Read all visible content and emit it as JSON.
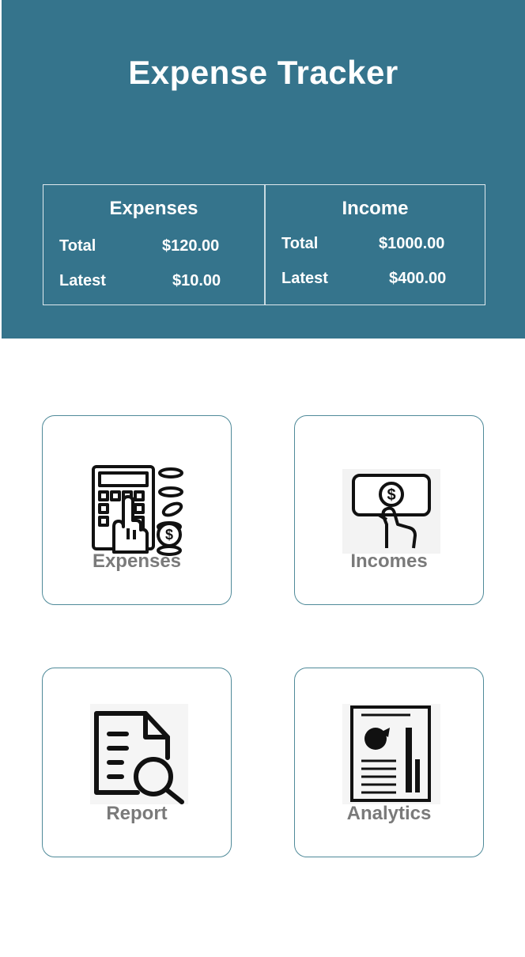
{
  "app": {
    "title": "Expense Tracker"
  },
  "summary": {
    "expenses": {
      "heading": "Expenses",
      "total_label": "Total",
      "total_value": "$120.00",
      "latest_label": "Latest",
      "latest_value": "$10.00"
    },
    "income": {
      "heading": "Income",
      "total_label": "Total",
      "total_value": "$1000.00",
      "latest_label": "Latest",
      "latest_value": "$400.00"
    }
  },
  "menu": {
    "expenses": {
      "label": "Expenses",
      "icon": "calculator-coins-icon"
    },
    "incomes": {
      "label": "Incomes",
      "icon": "hand-banknote-icon"
    },
    "report": {
      "label": "Report",
      "icon": "document-search-icon"
    },
    "analytics": {
      "label": "Analytics",
      "icon": "analytics-report-icon"
    }
  },
  "colors": {
    "header_bg": "#35748c",
    "tile_border": "#4f8a99",
    "tile_label": "#7a7a7a"
  }
}
